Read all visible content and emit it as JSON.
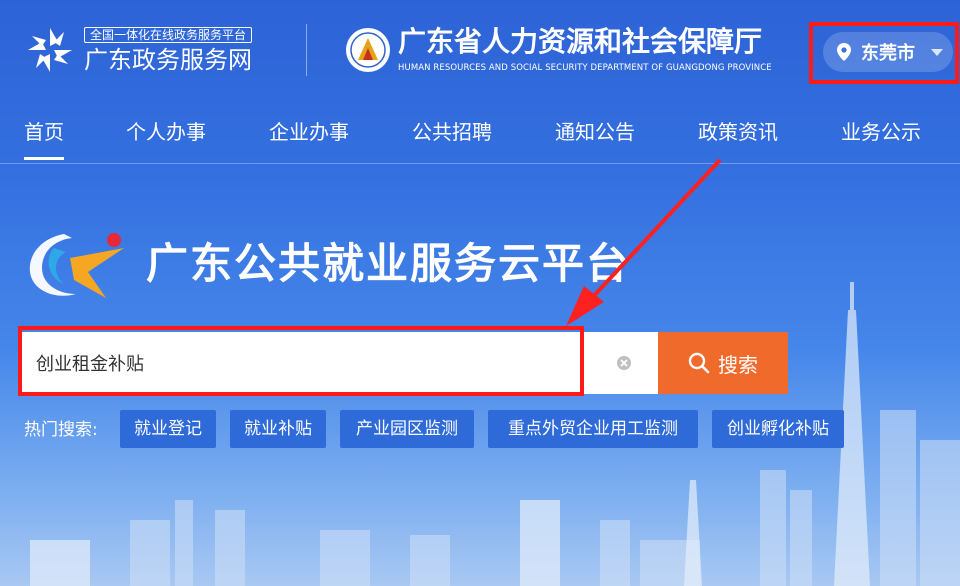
{
  "header": {
    "gd_tag": "全国一体化在线政务服务平台",
    "gd_name": "广东政务服务网",
    "hr_name": "广东省人力资源和社会保障厅",
    "hr_en": "HUMAN RESOURCES AND SOCIAL SECURITY DEPARTMENT OF GUANGDONG PROVINCE",
    "city": "东莞市",
    "city_icon": "location-pin-icon"
  },
  "nav": {
    "items": [
      "首页",
      "个人办事",
      "企业办事",
      "公共招聘",
      "通知公告",
      "政策资讯",
      "业务公示"
    ],
    "active": "首页"
  },
  "platform": {
    "title": "广东公共就业服务云平台"
  },
  "search": {
    "value": "创业租金补贴",
    "button_label": "搜索",
    "clear_icon": "clear-icon",
    "search_icon": "search-icon"
  },
  "hot": {
    "label": "热门搜索:",
    "tags": [
      "就业登记",
      "就业补贴",
      "产业园区监测",
      "重点外贸企业用工监测",
      "创业孵化补贴"
    ]
  },
  "colors": {
    "background": "#3470e0",
    "search_button": "#f06a2b",
    "highlight": "#ff1a1a",
    "tag_bg": "#2e6ad8"
  }
}
